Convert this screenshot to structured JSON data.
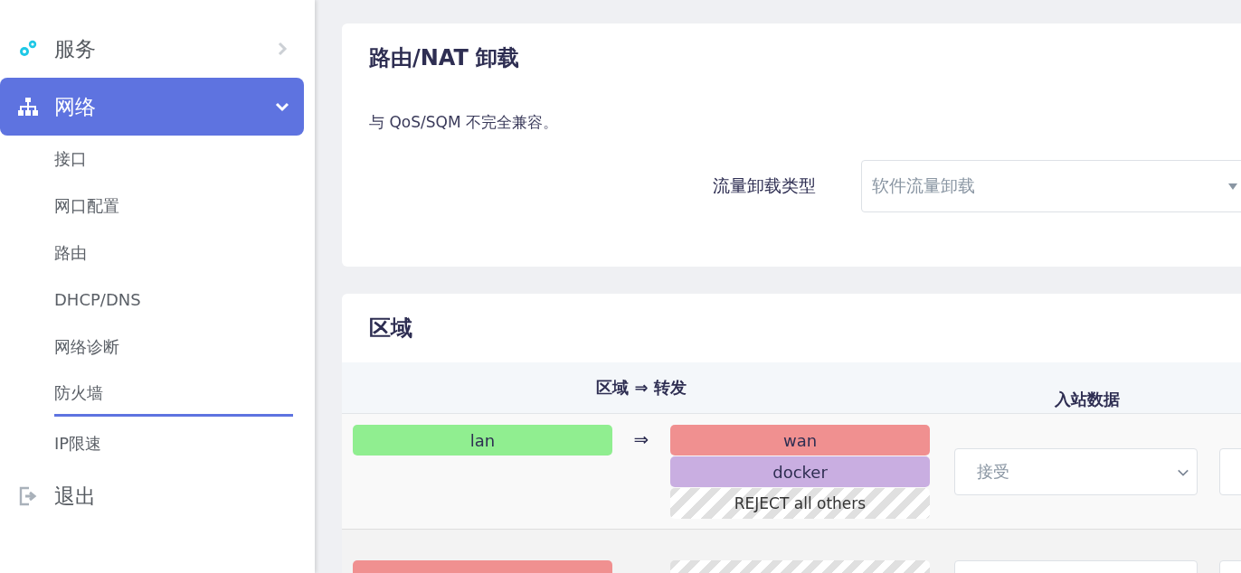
{
  "sidebar": {
    "items": [
      {
        "label": "服务",
        "kind": "gears",
        "selected": false,
        "expanded": false
      },
      {
        "label": "网络",
        "kind": "network",
        "selected": true,
        "expanded": true,
        "children": [
          {
            "label": "接口",
            "selected": false
          },
          {
            "label": "网口配置",
            "selected": false
          },
          {
            "label": "路由",
            "selected": false
          },
          {
            "label": "DHCP/DNS",
            "selected": false
          },
          {
            "label": "网络诊断",
            "selected": false
          },
          {
            "label": "防火墙",
            "selected": true
          },
          {
            "label": "IP限速",
            "selected": false
          }
        ]
      },
      {
        "label": "退出",
        "kind": "logout"
      }
    ]
  },
  "offload_section": {
    "title": "路由/NAT 卸载",
    "description": "与 QoS/SQM 不完全兼容。",
    "field_label": "流量卸载类型",
    "field_value": "软件流量卸载"
  },
  "zones_section": {
    "title": "区域",
    "columns": [
      "区域 ⇒ 转发",
      "入站数据"
    ],
    "rows": [
      {
        "zone": {
          "name": "lan",
          "color": "#90ee90"
        },
        "arrow": "⇒",
        "forwards": [
          {
            "kind": "zone",
            "name": "wan",
            "color": "#f09090"
          },
          {
            "kind": "zone",
            "name": "docker",
            "color": "#c9aee1"
          },
          {
            "kind": "reject",
            "name": "REJECT all others"
          }
        ],
        "input": "接受"
      },
      {
        "zone": {
          "color": "#f09090"
        },
        "forwards": [
          {
            "kind": "reject"
          }
        ]
      }
    ]
  }
}
